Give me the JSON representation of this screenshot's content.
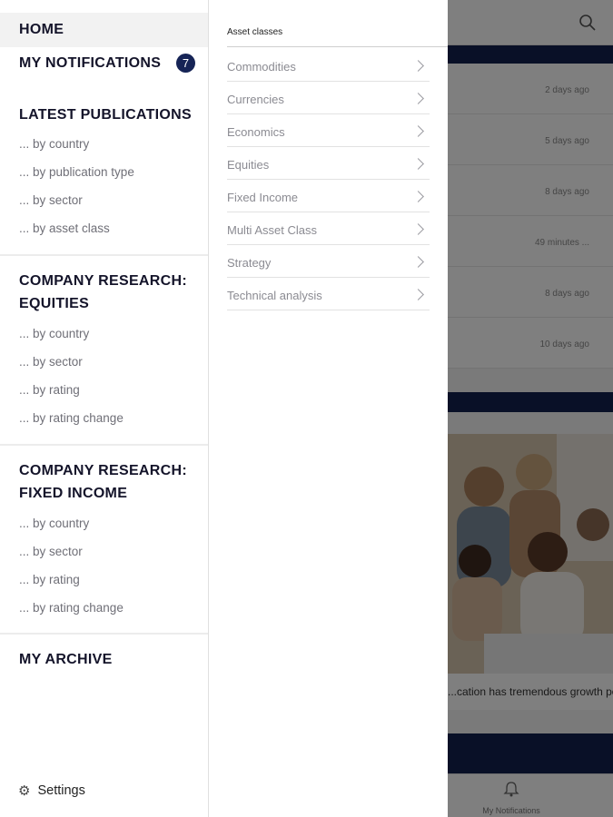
{
  "drawer": {
    "home": "HOME",
    "notifications": "MY NOTIFICATIONS",
    "notifications_count": "7",
    "latest": {
      "title": "LATEST PUBLICATIONS",
      "items": [
        "... by country",
        "... by publication type",
        "... by sector",
        "... by asset class"
      ]
    },
    "equities": {
      "title": "COMPANY RESEARCH: EQUITIES",
      "items": [
        "... by country",
        "... by sector",
        "... by rating",
        "... by rating change"
      ]
    },
    "fixed_income": {
      "title": "COMPANY RESEARCH: FIXED INCOME",
      "items": [
        "... by country",
        "... by sector",
        "... by rating",
        "... by rating change"
      ]
    },
    "archive": "MY ARCHIVE",
    "settings": "Settings"
  },
  "submenu": {
    "title": "Asset classes",
    "items": [
      "Commodities",
      "Currencies",
      "Economics",
      "Equities",
      "Fixed Income",
      "Multi Asset Class",
      "Strategy",
      "Technical analysis"
    ]
  },
  "background": {
    "times": [
      "2 days ago",
      "5 days ago",
      "8 days ago",
      "49 minutes ...",
      "8 days ago",
      "10 days ago"
    ],
    "caption": "...cation has tremendous growth pot",
    "tab_notifications": "My Notifications"
  },
  "colors": {
    "accent": "#162456",
    "navy": "#12204f"
  },
  "icons": {
    "search": "search-icon",
    "settings": "gear-icon",
    "chevron": "chevron-right-icon",
    "notifications_tab": "bell-icon"
  }
}
